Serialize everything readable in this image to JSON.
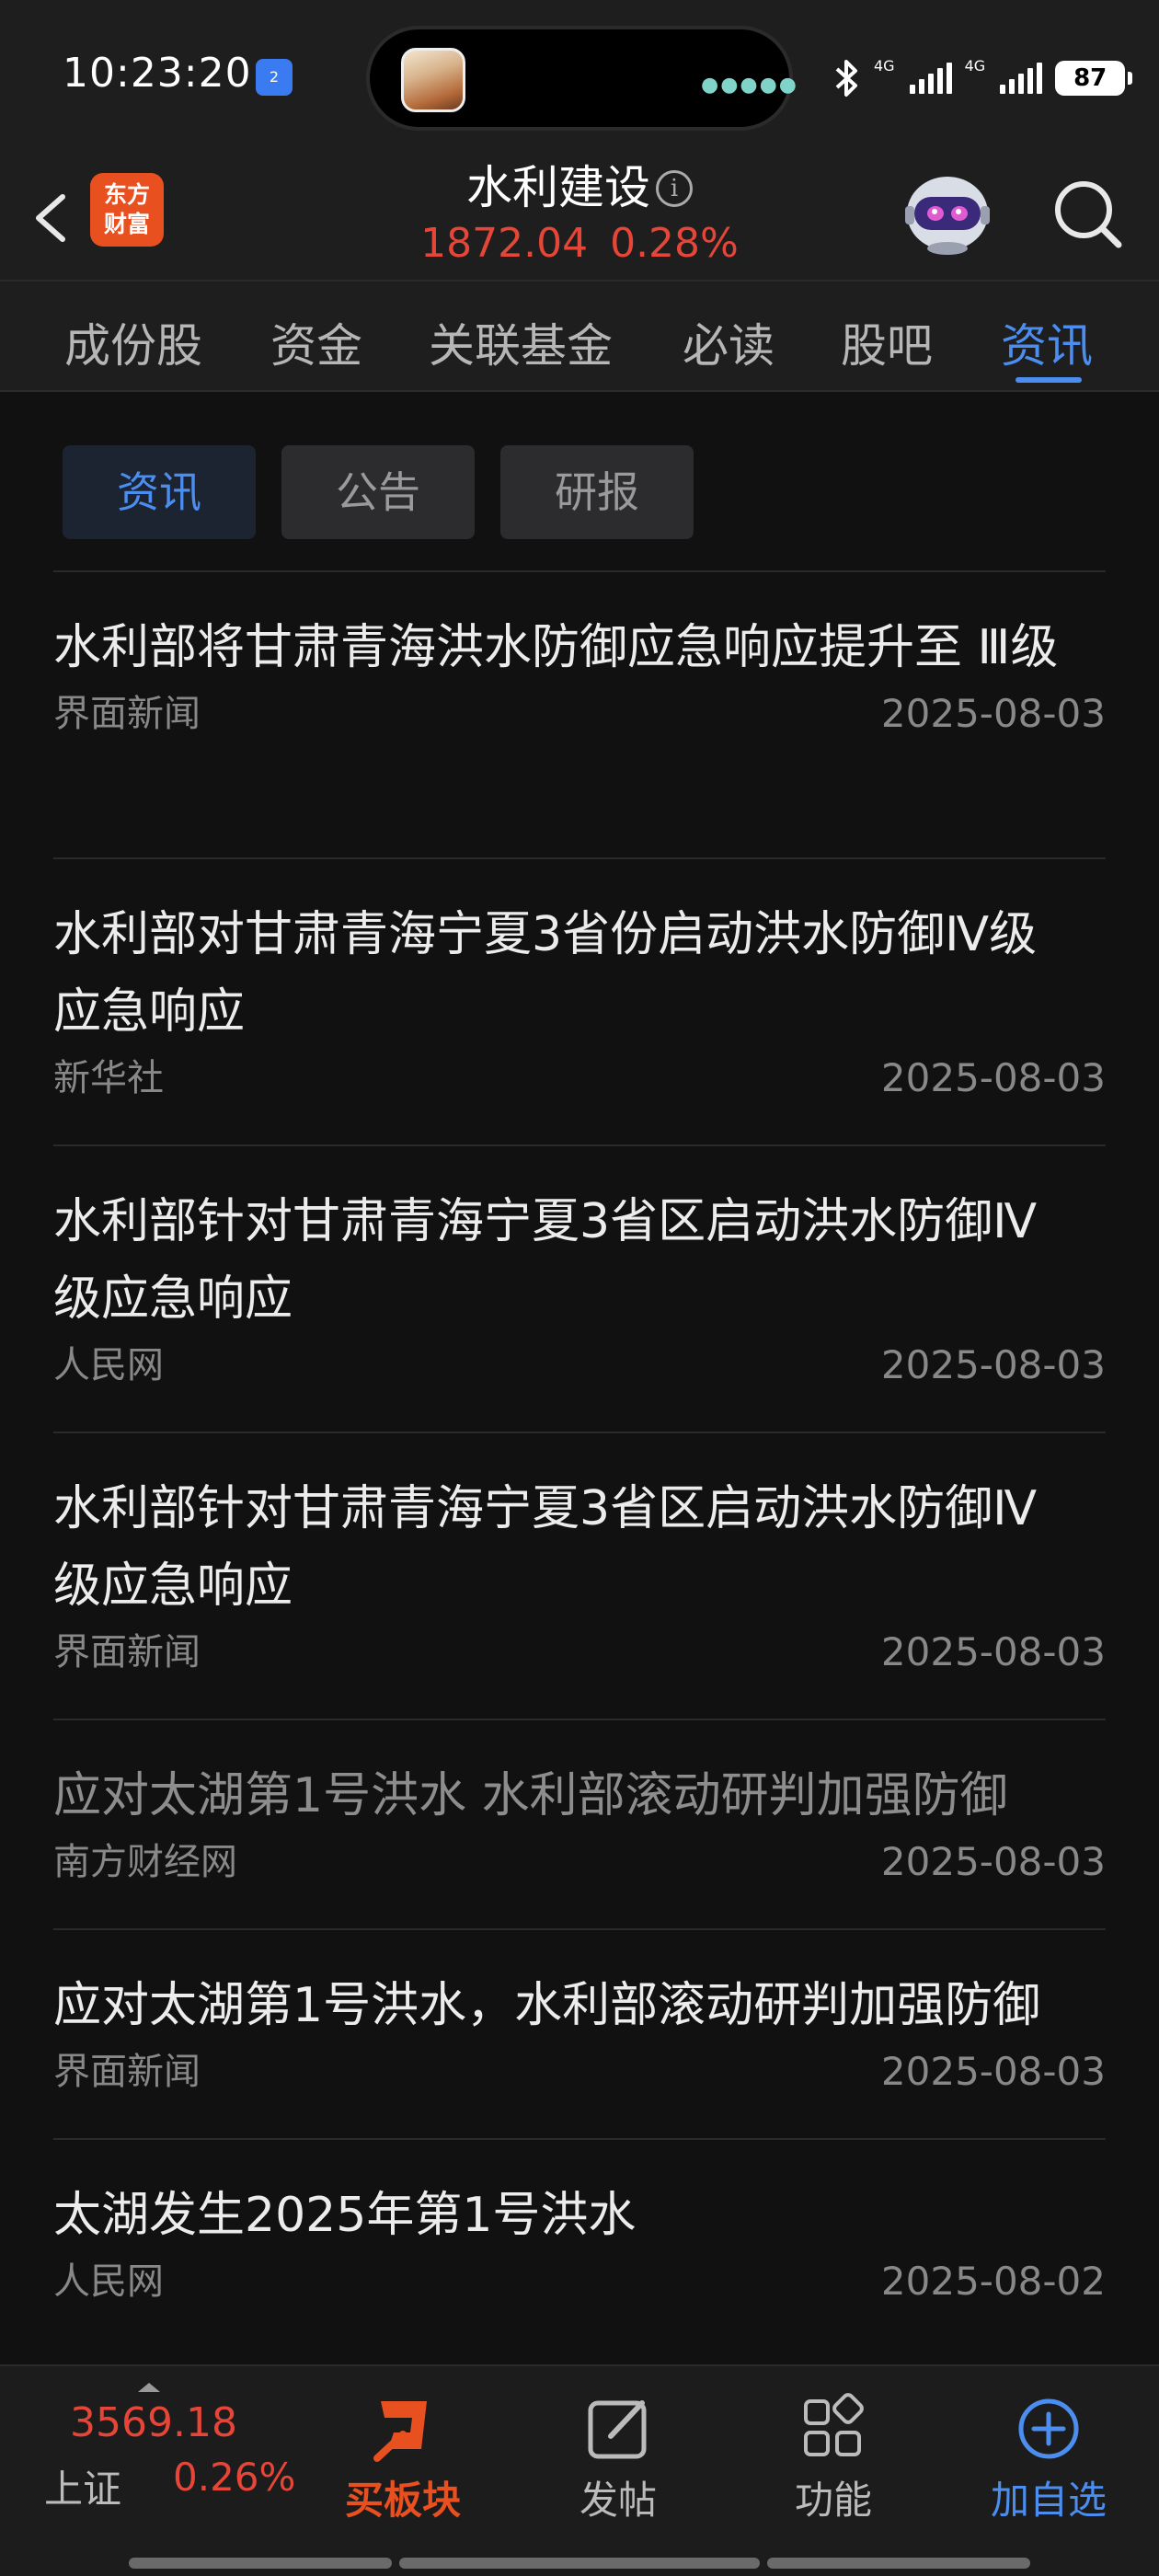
{
  "status_bar": {
    "time": "10:23:20",
    "nfc_badge": "2",
    "signal_1": "4G",
    "signal_2": "4G",
    "battery": "87"
  },
  "header": {
    "logo_line1": "东方",
    "logo_line2": "财富",
    "title": "水利建设",
    "info_icon": "i",
    "price": "1872.04",
    "change_pct": "0.28%",
    "accent_up": "#e54638"
  },
  "tabs": [
    {
      "label": "成份股"
    },
    {
      "label": "资金"
    },
    {
      "label": "关联基金"
    },
    {
      "label": "必读"
    },
    {
      "label": "股吧"
    },
    {
      "label": "资讯",
      "active": true
    }
  ],
  "subtabs": [
    {
      "label": "资讯",
      "active": true
    },
    {
      "label": "公告"
    },
    {
      "label": "研报"
    }
  ],
  "news": [
    {
      "title": "水利部将甘肃青海洪水防御应急响应提升至 Ⅲ级",
      "source": "界面新闻",
      "date": "2025-08-03"
    },
    {
      "title": "水利部对甘肃青海宁夏3省份启动洪水防御Ⅳ级应急响应",
      "source": "新华社",
      "date": "2025-08-03"
    },
    {
      "title": "水利部针对甘肃青海宁夏3省区启动洪水防御Ⅳ级应急响应",
      "source": "人民网",
      "date": "2025-08-03"
    },
    {
      "title": "水利部针对甘肃青海宁夏3省区启动洪水防御Ⅳ级应急响应",
      "source": "界面新闻",
      "date": "2025-08-03"
    },
    {
      "title": "应对太湖第1号洪水 水利部滚动研判加强防御",
      "source": "南方财经网",
      "date": "2025-08-03",
      "read": true
    },
    {
      "title": "应对太湖第1号洪水，水利部滚动研判加强防御",
      "source": "界面新闻",
      "date": "2025-08-03"
    },
    {
      "title": "太湖发生2025年第1号洪水",
      "source": "人民网",
      "date": "2025-08-02"
    }
  ],
  "bottom_bar": {
    "index_value": "3569.18",
    "index_name": "上证",
    "index_pct": "0.26%",
    "buy_sector": "买板块",
    "post": "发帖",
    "functions": "功能",
    "add_watchlist": "加自选"
  }
}
